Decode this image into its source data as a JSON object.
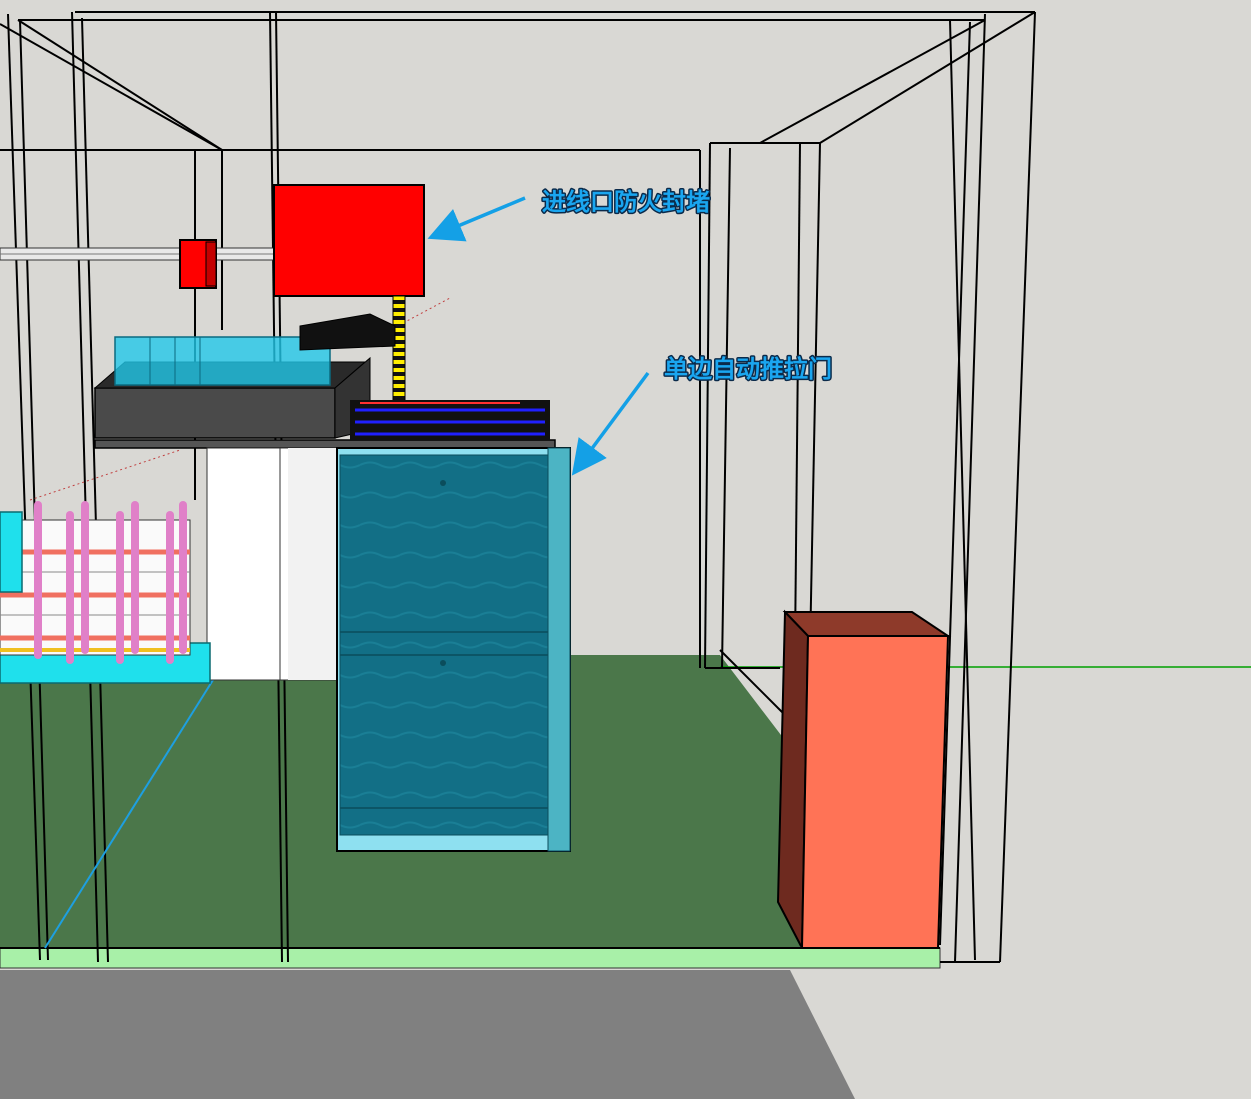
{
  "annotations": {
    "fire_seal": {
      "label": "进线口防火封堵"
    },
    "sliding_door": {
      "label": "单边自动推拉门"
    }
  },
  "colors": {
    "background": "#d9d8d4",
    "floor": "#4b774a",
    "floor_edge": "#a8f0a8",
    "ground": "#808080",
    "fire_seal_box": "#ff0000",
    "door_glass": "#0f6f86",
    "cabinet_front": "#ff7356",
    "cabinet_side": "#6e2a1f",
    "arrow": "#14a0e6",
    "label_text": "#1aa6f0",
    "wire_line": "#000000",
    "guide_line": "#00a000"
  },
  "icons": {
    "fire_seal_arrow": "arrow-icon",
    "door_arrow": "arrow-icon"
  }
}
